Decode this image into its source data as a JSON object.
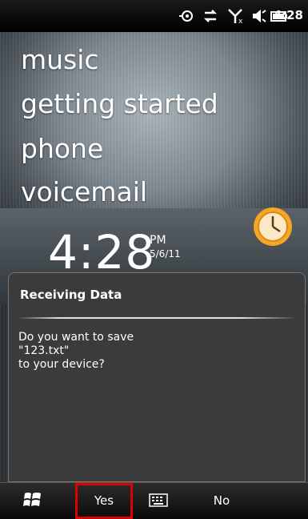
{
  "status": {
    "time": "4:28",
    "icons": [
      "gps-icon",
      "data-sync-icon",
      "signal-off-icon",
      "speaker-icon",
      "battery-icon"
    ]
  },
  "home": {
    "menu": [
      "music",
      "getting started",
      "phone",
      "voicemail"
    ],
    "clock": {
      "time": "4:28",
      "ampm": "PM",
      "date": "5/6/11"
    }
  },
  "dialog": {
    "title": "Receiving Data",
    "message": "Do you want to save\n\"123.txt\"\nto your device?"
  },
  "softkeys": {
    "left": "Yes",
    "right": "No"
  },
  "colors": {
    "highlight": "#e00000",
    "dialog_bg": "#3b3b3b"
  }
}
